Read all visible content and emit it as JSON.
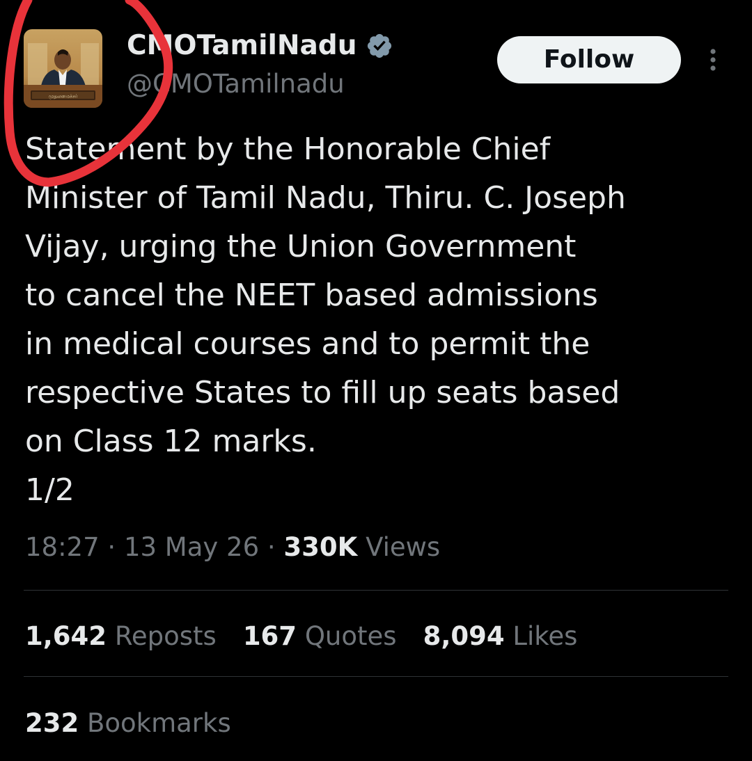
{
  "account": {
    "display_name": "CMOTamilNadu",
    "handle": "@CMOTamilnadu",
    "verified": true,
    "verified_color": "#829aab",
    "avatar_caption": "முதலமைச்சர்"
  },
  "actions": {
    "follow_label": "Follow",
    "more_icon": "more-vertical-icon"
  },
  "tweet": {
    "lines": [
      "Statement by the Honorable Chief",
      "Minister of Tamil Nadu, Thiru. C. Joseph",
      "Vijay, urging the Union Government",
      "to cancel the NEET based admissions",
      "in medical courses and to permit the",
      "respective States to fill up seats based",
      "on Class 12 marks.",
      "1/2"
    ]
  },
  "meta": {
    "time": "18:27",
    "separator": " · ",
    "date": "13 May 26",
    "views_count": "330K",
    "views_label": "Views"
  },
  "stats": {
    "reposts_count": "1,642",
    "reposts_label": "Reposts",
    "quotes_count": "167",
    "quotes_label": "Quotes",
    "likes_count": "8,094",
    "likes_label": "Likes",
    "bookmarks_count": "232",
    "bookmarks_label": "Bookmarks"
  },
  "colors": {
    "background": "#000000",
    "text_primary": "#e7e9ea",
    "text_secondary": "#71767b",
    "divider": "#2f3336",
    "follow_bg": "#eff3f4",
    "annotation_red": "#e8333a"
  }
}
